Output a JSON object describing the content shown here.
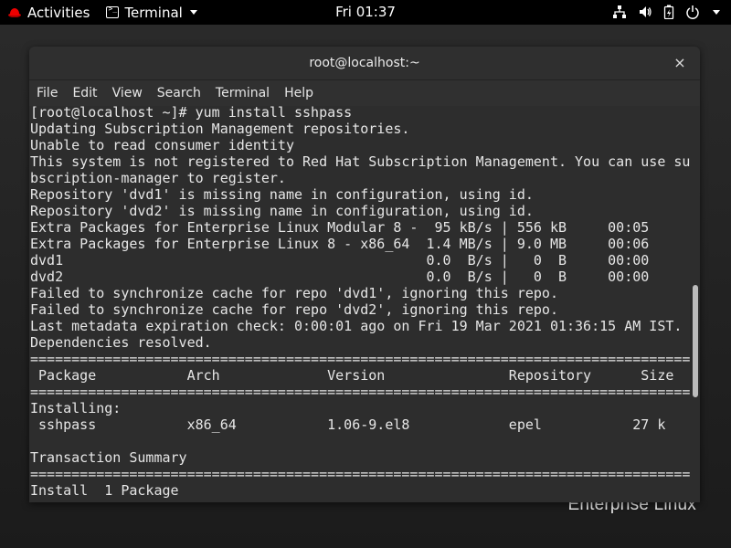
{
  "topbar": {
    "activities_label": "Activities",
    "app_label": "Terminal",
    "clock": "Fri 01:37",
    "tray_icons": [
      "network-icon",
      "volume-icon",
      "battery-icon",
      "power-icon"
    ]
  },
  "window": {
    "title": "root@localhost:~",
    "close_label": "×",
    "menu": [
      "File",
      "Edit",
      "View",
      "Search",
      "Terminal",
      "Help"
    ]
  },
  "terminal_lines": [
    "[root@localhost ~]# yum install sshpass",
    "Updating Subscription Management repositories.",
    "Unable to read consumer identity",
    "This system is not registered to Red Hat Subscription Management. You can use su",
    "bscription-manager to register.",
    "Repository 'dvd1' is missing name in configuration, using id.",
    "Repository 'dvd2' is missing name in configuration, using id.",
    "Extra Packages for Enterprise Linux Modular 8 -  95 kB/s | 556 kB     00:05",
    "Extra Packages for Enterprise Linux 8 - x86_64  1.4 MB/s | 9.0 MB     00:06",
    "dvd1                                            0.0  B/s |   0  B     00:00",
    "dvd2                                            0.0  B/s |   0  B     00:00",
    "Failed to synchronize cache for repo 'dvd1', ignoring this repo.",
    "Failed to synchronize cache for repo 'dvd2', ignoring this repo.",
    "Last metadata expiration check: 0:00:01 ago on Fri 19 Mar 2021 01:36:15 AM IST.",
    "Dependencies resolved.",
    "================================================================================",
    " Package           Arch             Version               Repository      Size",
    "================================================================================",
    "Installing:",
    " sshpass           x86_64           1.06-9.el8            epel           27 k",
    "",
    "Transaction Summary",
    "================================================================================",
    "Install  1 Package"
  ],
  "desktop": {
    "brand_text": "Enterprise Linux"
  }
}
